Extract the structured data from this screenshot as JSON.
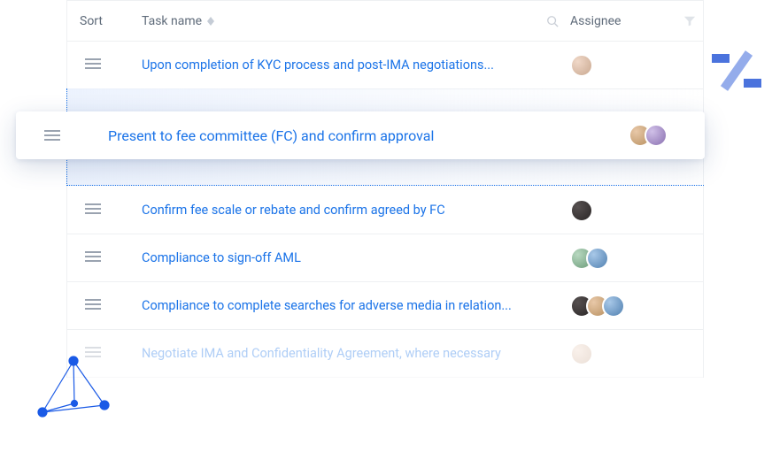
{
  "header": {
    "sort_label": "Sort",
    "taskname_label": "Task name",
    "assignee_label": "Assignee"
  },
  "rows": [
    {
      "task": "Upon completion of KYC process and post-IMA negotiations...",
      "avatars": [
        "av1"
      ]
    },
    {
      "task": "Confirm fee scale or rebate and confirm agreed by FC",
      "avatars": [
        "av6"
      ]
    },
    {
      "task": "Compliance to sign-off AML",
      "avatars": [
        "av2",
        "av5"
      ]
    },
    {
      "task": "Compliance to complete searches for adverse media in relation...",
      "avatars": [
        "av6",
        "av4",
        "av5"
      ]
    },
    {
      "task": "Negotiate IMA and Confidentiality Agreement, where necessary",
      "avatars": [
        "av1"
      ],
      "faded": true
    }
  ],
  "floating": {
    "task": "Present to fee committee (FC) and confirm approval",
    "avatars": [
      "av4",
      "av3"
    ]
  }
}
